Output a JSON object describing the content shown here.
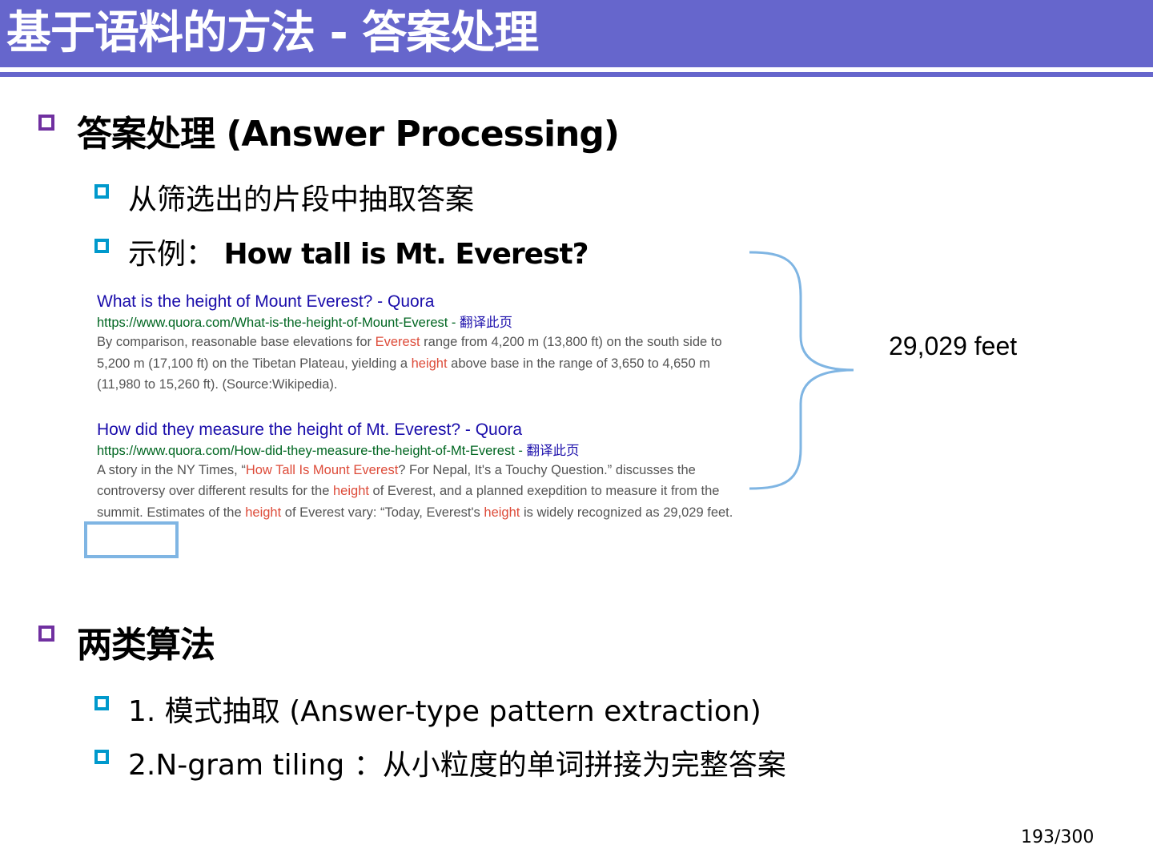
{
  "slide": {
    "title": "基于语料的方法 - 答案处理",
    "page_number": "193/300"
  },
  "section1": {
    "heading": "答案处理 (Answer Processing)",
    "items": [
      {
        "text": "从筛选出的片段中抽取答案"
      },
      {
        "label": "示例：",
        "question": "How tall is Mt. Everest?"
      }
    ]
  },
  "search_results": [
    {
      "title": "What is the height of Mount Everest? - Quora",
      "url": "https://www.quora.com/What-is-the-height-of-Mount-Everest",
      "url_sep": " - ",
      "translate": "翻译此页",
      "body": [
        {
          "t": "By comparison, reasonable base elevations for "
        },
        {
          "t": "Everest",
          "hl": true
        },
        {
          "t": " range from 4,200 m (13,800 ft) on the south side to 5,200 m (17,100 ft) on the Tibetan Plateau, yielding a "
        },
        {
          "t": "height",
          "hl": true
        },
        {
          "t": " above base in the range of 3,650 to 4,650 m (11,980 to 15,260 ft). (Source:Wikipedia)."
        }
      ]
    },
    {
      "title": "How did they measure the height of Mt. Everest? - Quora",
      "url": "https://www.quora.com/How-did-they-measure-the-height-of-Mt-Everest",
      "url_sep": " - ",
      "translate": "翻译此页",
      "body": [
        {
          "t": "A story in the NY Times, “"
        },
        {
          "t": "How Tall Is Mount Everest",
          "hl": true
        },
        {
          "t": "? For Nepal, It's a Touchy Question.” discusses the controversy over different results for the "
        },
        {
          "t": "height",
          "hl": true
        },
        {
          "t": " of Everest, and a planned exepdition to measure it from the summit. Estimates of the "
        },
        {
          "t": "height",
          "hl": true
        },
        {
          "t": " of Everest vary: “Today, Everest's "
        },
        {
          "t": "height",
          "hl": true
        },
        {
          "t": " is widely recognized as 29,029 feet."
        }
      ]
    }
  ],
  "extracted_answer": "29,029 feet",
  "section2": {
    "heading": "两类算法",
    "items": [
      "1. 模式抽取 (Answer-type pattern extraction)",
      "2.N-gram tiling ：从小粒度的单词拼接为完整答案"
    ]
  },
  "colors": {
    "title_bar": "#6666cc",
    "bullet_level1": "#7030a0",
    "bullet_level2": "#0099cc",
    "link": "#1a0dab",
    "url": "#006621",
    "highlight": "#dd4b39",
    "brace": "#7fb5e3"
  }
}
